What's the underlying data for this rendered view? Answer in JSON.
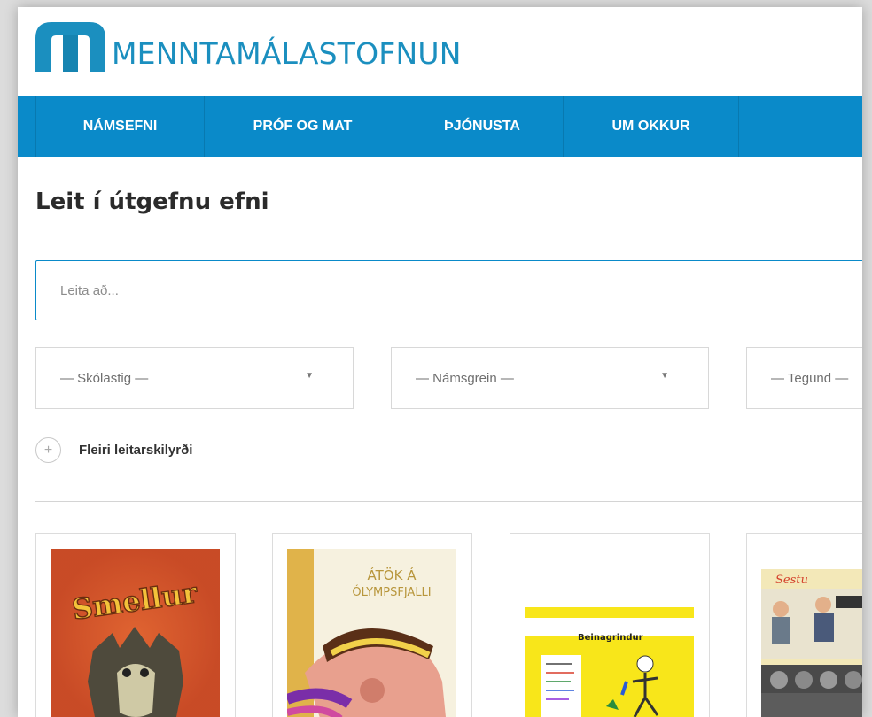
{
  "brand": {
    "name": "MENNTAMÁLASTOFNUN",
    "color": "#1b8fbf",
    "nav_color": "#0a8ac9"
  },
  "nav": {
    "items": [
      {
        "label": "NÁMSEFNI"
      },
      {
        "label": "PRÓF OG MAT"
      },
      {
        "label": "ÞJÓNUSTA"
      },
      {
        "label": "UM OKKUR"
      }
    ]
  },
  "page": {
    "title": "Leit í útgefnu efni"
  },
  "search": {
    "placeholder": "Leita að..."
  },
  "filters": {
    "school_level": "— Skólastig —",
    "subject": "— Námsgrein —",
    "type": "— Tegund —"
  },
  "more_criteria": {
    "label": "Fleiri leitarskilyrði",
    "icon": "plus-circle-icon"
  },
  "books": [
    {
      "cover_text": "Smellur",
      "cover_subtext": ""
    },
    {
      "cover_text": "ÁTÖK Á ÓLYMPSFJALLI"
    },
    {
      "cover_text": "Beinagrindur"
    },
    {
      "cover_text": "Sestu"
    }
  ]
}
